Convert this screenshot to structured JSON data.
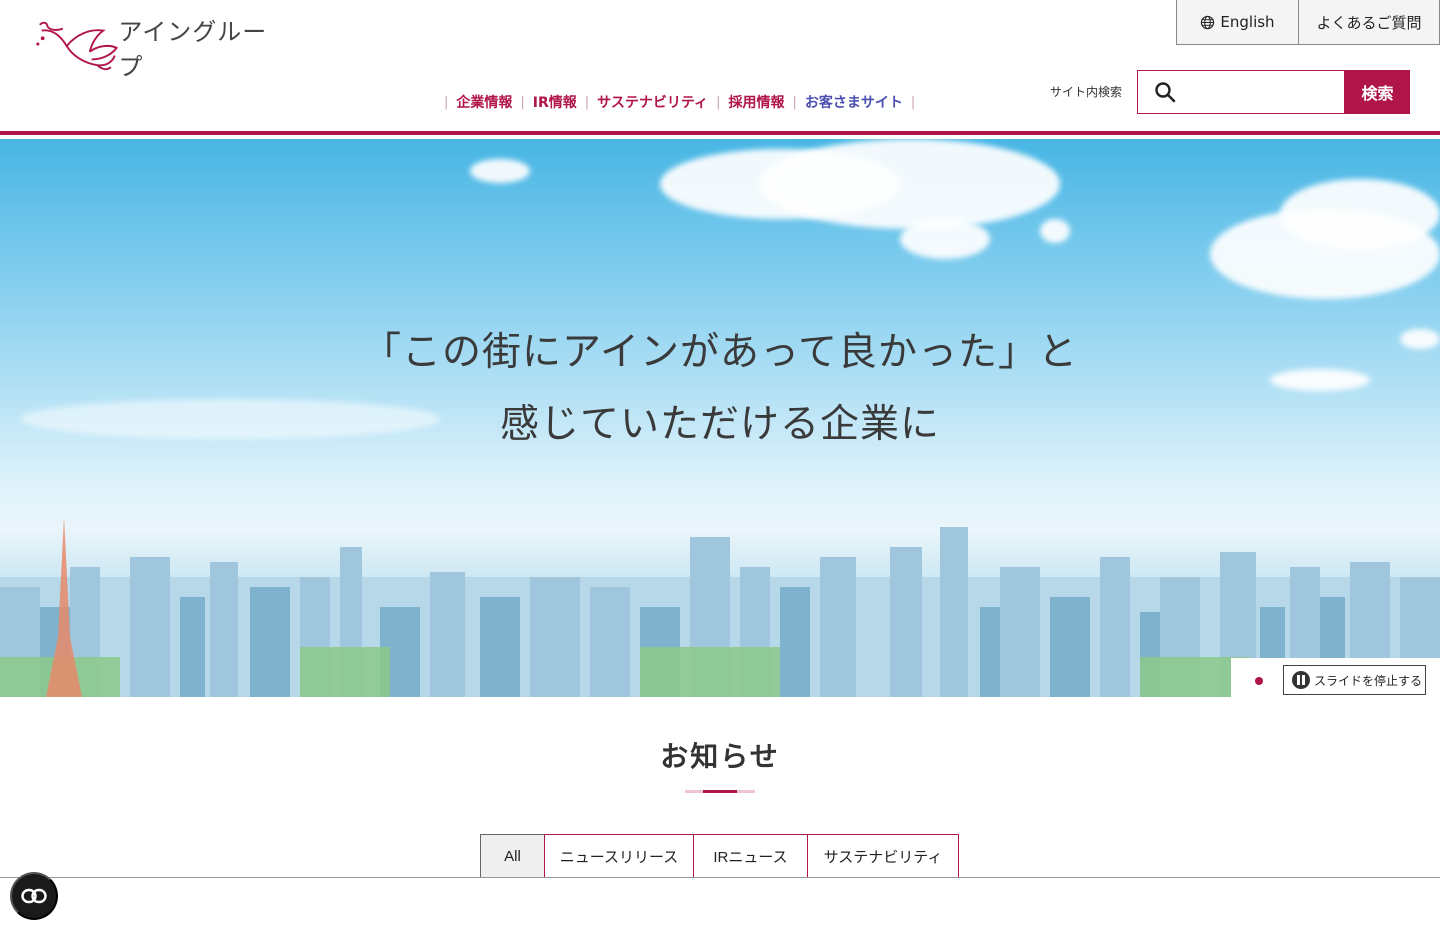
{
  "header": {
    "logo_text": "アイングループ",
    "lang_label": "English",
    "faq_label": "よくあるご質問",
    "nav": [
      {
        "label": "企業情報"
      },
      {
        "label": "IR情報"
      },
      {
        "label": "サステナビリティ"
      },
      {
        "label": "採用情報"
      },
      {
        "label": "お客さまサイト"
      }
    ],
    "search_label": "サイト内検索",
    "search_placeholder": "",
    "search_button": "検索"
  },
  "hero": {
    "line1": "「この街にアインがあって良かった」と",
    "line2": "感じていただける企業に",
    "stop_label": "スライドを停止する"
  },
  "news": {
    "title": "お知らせ",
    "tabs": [
      {
        "label": "All"
      },
      {
        "label": "ニュースリリース"
      },
      {
        "label": "IRニュース"
      },
      {
        "label": "サステナビリティ"
      }
    ]
  },
  "colors": {
    "brand": "#b0154a",
    "customer_link": "#4a4fb0"
  },
  "icons": [
    "globe-icon",
    "search-icon",
    "pause-icon",
    "accessibility-icon",
    "dove-logo-icon"
  ]
}
